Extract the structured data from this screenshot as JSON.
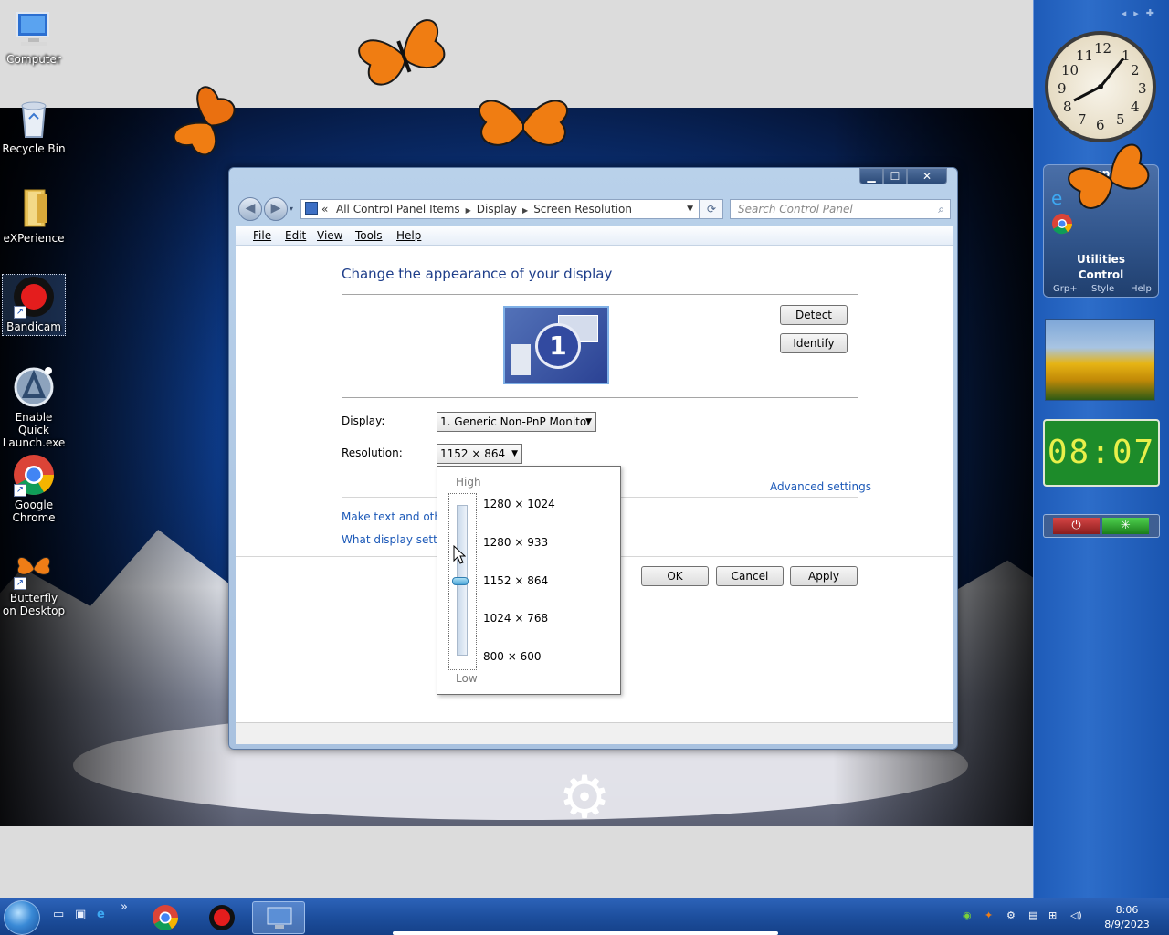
{
  "desktop": {
    "icons": [
      {
        "label": "Computer",
        "icon": "computer-icon"
      },
      {
        "label": "Recycle Bin",
        "icon": "recycle-bin-icon"
      },
      {
        "label": "eXPerience",
        "icon": "folder-icon"
      },
      {
        "label": "Bandicam",
        "icon": "bandicam-icon"
      },
      {
        "label": "Enable Quick Launch.exe",
        "icon": "quick-launch-icon"
      },
      {
        "label": "Google Chrome",
        "icon": "chrome-icon"
      },
      {
        "label": "Butterfly on Desktop",
        "icon": "butterfly-icon"
      }
    ]
  },
  "sidebar": {
    "clock_numbers": [
      "12",
      "1",
      "2",
      "3",
      "4",
      "5",
      "6",
      "7",
      "8",
      "9",
      "10",
      "11"
    ],
    "apps_title": "Apps",
    "utilities_label": "Utilities",
    "control_label": "Control",
    "footer": [
      "Grp+",
      "Style",
      "Help"
    ],
    "digital_time": "08:07"
  },
  "window": {
    "breadcrumb": [
      "All Control Panel Items",
      "Display",
      "Screen Resolution"
    ],
    "breadcrumb_prefix": "«",
    "search_placeholder": "Search Control Panel",
    "menu": [
      "File",
      "Edit",
      "View",
      "Tools",
      "Help"
    ],
    "heading": "Change the appearance of your display",
    "monitor_number": "1",
    "detect_label": "Detect",
    "identify_label": "Identify",
    "display_label": "Display:",
    "display_value": "1. Generic Non-PnP Monitor",
    "resolution_label": "Resolution:",
    "resolution_value": "1152 × 864",
    "advanced_link": "Advanced settings",
    "link_text_size": "Make text and other",
    "link_display_settings": "What display setting",
    "ok_label": "OK",
    "cancel_label": "Cancel",
    "apply_label": "Apply",
    "dropdown": {
      "high_label": "High",
      "low_label": "Low",
      "options": [
        "1280 × 1024",
        "1280 × 933",
        "1152 × 864",
        "1024 × 768",
        "800 × 600"
      ],
      "selected": "1152 × 864"
    }
  },
  "taskbar": {
    "time": "8:06",
    "date": "8/9/2023"
  }
}
